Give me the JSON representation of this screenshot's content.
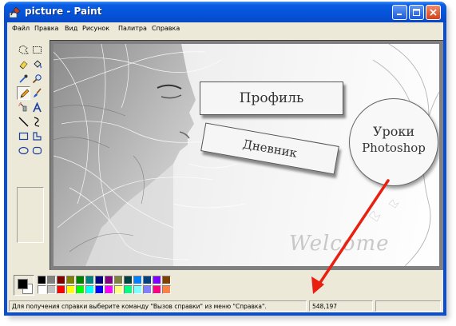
{
  "window": {
    "title": "picture - Paint",
    "app_icon": "paint-brush-icon",
    "controls": {
      "minimize_icon": "minimize-icon",
      "maximize_icon": "maximize-icon",
      "close_icon": "close-icon"
    }
  },
  "menu": [
    {
      "label": "Файл"
    },
    {
      "label": "Правка"
    },
    {
      "label": "Вид"
    },
    {
      "label": "Рисунок"
    },
    {
      "label": "Палитра"
    },
    {
      "label": "Справка"
    }
  ],
  "tools": [
    {
      "icon": "free-form-select-icon"
    },
    {
      "icon": "select-icon"
    },
    {
      "icon": "eraser-icon"
    },
    {
      "icon": "fill-icon"
    },
    {
      "icon": "pick-color-icon"
    },
    {
      "icon": "magnifier-icon"
    },
    {
      "icon": "pencil-icon",
      "selected": true
    },
    {
      "icon": "brush-icon"
    },
    {
      "icon": "airbrush-icon"
    },
    {
      "icon": "text-icon"
    },
    {
      "icon": "line-icon"
    },
    {
      "icon": "curve-icon"
    },
    {
      "icon": "rectangle-icon"
    },
    {
      "icon": "polygon-icon"
    },
    {
      "icon": "ellipse-icon"
    },
    {
      "icon": "rounded-rectangle-icon"
    }
  ],
  "canvas": {
    "label_profile": "Профиль",
    "label_diary": "Дневник",
    "circle_line1": "Уроки",
    "circle_line2": "Photoshop",
    "watermark": "Welcome"
  },
  "palette": {
    "foreground": "#000000",
    "background": "#ffffff",
    "colors": [
      "#000000",
      "#808080",
      "#800000",
      "#808000",
      "#008000",
      "#008080",
      "#000080",
      "#800080",
      "#808040",
      "#004040",
      "#0080ff",
      "#004080",
      "#8000ff",
      "#804000",
      "#ffffff",
      "#c0c0c0",
      "#ff0000",
      "#ffff00",
      "#00ff00",
      "#00ffff",
      "#0000ff",
      "#ff00ff",
      "#ffff80",
      "#00ff80",
      "#80ffff",
      "#8080ff",
      "#ff0080",
      "#ff8040"
    ]
  },
  "status": {
    "help_text": "Для получения справки выберите команду \"Вызов справки\" из меню \"Справка\".",
    "coordinates": "548,197"
  },
  "colors": {
    "titlebar": "#0a55d8",
    "client": "#ece9d8",
    "arrow": "#e82010"
  }
}
